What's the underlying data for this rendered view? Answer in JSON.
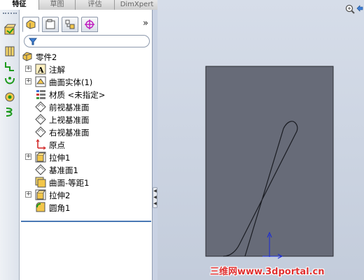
{
  "tabs": [
    {
      "label": "特征",
      "active": true
    },
    {
      "label": "草图",
      "active": false
    },
    {
      "label": "评估",
      "active": false
    },
    {
      "label": "DimXpert",
      "active": false
    }
  ],
  "panel": {
    "more_label": "»",
    "filter_placeholder": ""
  },
  "tree": {
    "root": "零件2",
    "items": [
      {
        "label": "注解",
        "icon": "annotation-icon",
        "expandable": true
      },
      {
        "label": "曲面实体(1)",
        "icon": "surface-bodies-icon",
        "expandable": true
      },
      {
        "label": "材质 <未指定>",
        "icon": "material-icon",
        "expandable": false
      },
      {
        "label": "前视基准面",
        "icon": "plane-icon",
        "expandable": false
      },
      {
        "label": "上视基准面",
        "icon": "plane-icon",
        "expandable": false
      },
      {
        "label": "右视基准面",
        "icon": "plane-icon",
        "expandable": false
      },
      {
        "label": "原点",
        "icon": "origin-icon",
        "expandable": false
      },
      {
        "label": "拉伸1",
        "icon": "extrude-icon",
        "expandable": true
      },
      {
        "label": "基准面1",
        "icon": "plane-icon",
        "expandable": false
      },
      {
        "label": "曲面-等距1",
        "icon": "offset-surface-icon",
        "expandable": false
      },
      {
        "label": "拉伸2",
        "icon": "extrude-icon",
        "expandable": true
      },
      {
        "label": "圆角1",
        "icon": "fillet-icon",
        "expandable": false
      }
    ]
  },
  "watermark": "三维网www.3dportal.cn",
  "colors": {
    "part_face": "#676b78",
    "viewport_bg": "#c9d2e3",
    "selection_line": "#4a78b5",
    "watermark": "#e03030"
  }
}
